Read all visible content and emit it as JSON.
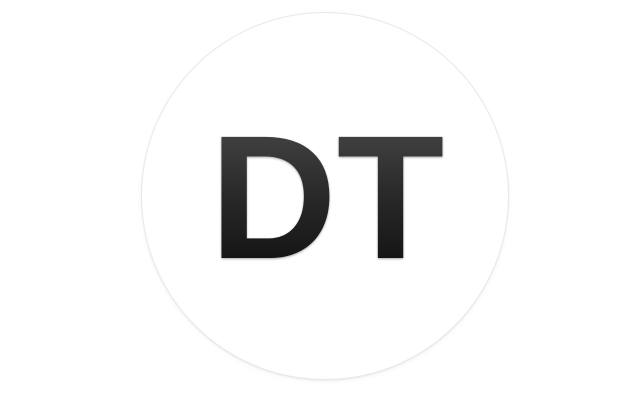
{
  "avatar": {
    "initials": "DT"
  },
  "colors": {
    "background": "#ffffff",
    "circle": "#ffffff",
    "circle_border": "#e8e8e8",
    "text_top": "#4a4a4a",
    "text_bottom": "#0d0d0d"
  }
}
